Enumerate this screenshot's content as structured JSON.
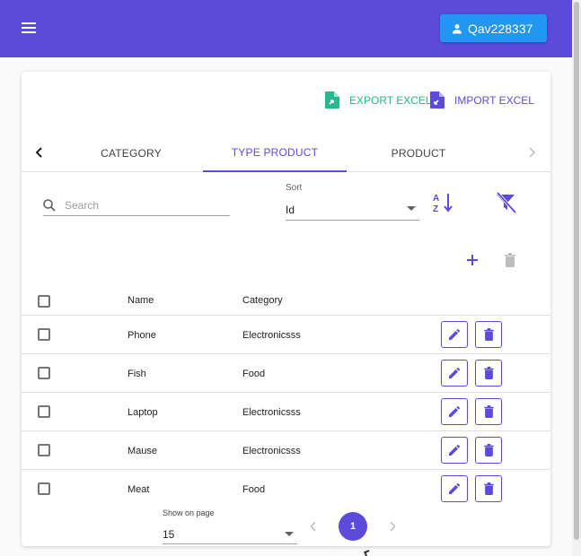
{
  "colors": {
    "primary": "#5c4bdb",
    "user_button": "#2196f3",
    "export": "#26b88e"
  },
  "appbar": {
    "menu_icon": "hamburger-menu-icon",
    "user_name": "Qav228337",
    "user_icon": "person-icon"
  },
  "toolbar": {
    "export_label": "EXPORT EXCEL",
    "import_label": "IMPORT EXCEL"
  },
  "tabs": [
    {
      "label": "CATEGORY",
      "active": false
    },
    {
      "label": "TYPE PRODUCT",
      "active": true
    },
    {
      "label": "PRODUCT",
      "active": false
    }
  ],
  "search": {
    "placeholder": "Search",
    "value": ""
  },
  "sort": {
    "label": "Sort",
    "value": "Id"
  },
  "table": {
    "columns": [
      "Name",
      "Category"
    ],
    "rows": [
      {
        "name": "Phone",
        "category": "Electronicsss"
      },
      {
        "name": "Fish",
        "category": "Food"
      },
      {
        "name": "Laptop",
        "category": "Electronicsss"
      },
      {
        "name": "Mause",
        "category": "Electronicsss"
      },
      {
        "name": "Meat",
        "category": "Food"
      }
    ]
  },
  "pagination": {
    "label": "Show on page",
    "page_size": "15",
    "current_page": "1"
  }
}
